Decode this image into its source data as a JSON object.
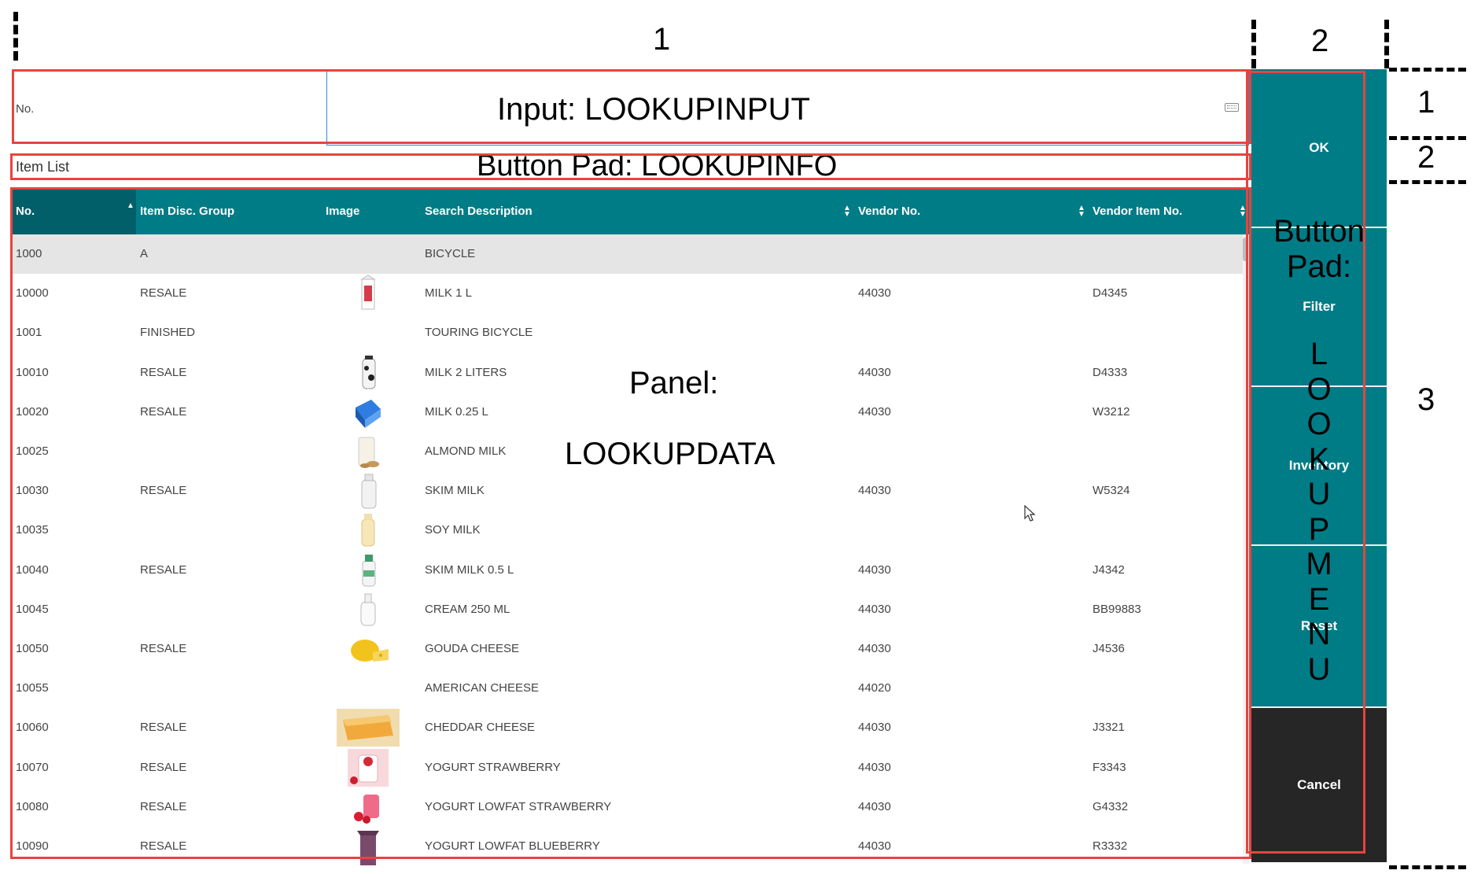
{
  "annotations": {
    "top_col1": "1",
    "top_col2": "2",
    "side_row1": "1",
    "side_row2": "2",
    "side_row3": "3",
    "input_label": "Input: LOOKUPINPUT",
    "info_label": "Button Pad: LOOKUPINFO",
    "panel_label_1": "Panel:",
    "panel_label_2": "LOOKUPDATA",
    "menu_label_1": "Button",
    "menu_label_2": "Pad:",
    "menu_label_letters": [
      "L",
      "O",
      "O",
      "K",
      "U",
      "P",
      "M",
      "E",
      "N",
      "U"
    ]
  },
  "input": {
    "label": "No.",
    "value": ""
  },
  "info": {
    "title": "Item List"
  },
  "table": {
    "columns": [
      "No.",
      "Item Disc. Group",
      "Image",
      "Search Description",
      "Vendor No.",
      "Vendor Item No."
    ],
    "rows": [
      {
        "no": "1000",
        "group": "A",
        "image": "",
        "desc": "BICYCLE",
        "vendor": "",
        "vendor_item": ""
      },
      {
        "no": "10000",
        "group": "RESALE",
        "image": "milk-carton",
        "desc": "MILK 1 L",
        "vendor": "44030",
        "vendor_item": "D4345"
      },
      {
        "no": "1001",
        "group": "FINISHED",
        "image": "",
        "desc": "TOURING BICYCLE",
        "vendor": "",
        "vendor_item": ""
      },
      {
        "no": "10010",
        "group": "RESALE",
        "image": "milk-cow-bottle",
        "desc": "MILK 2 LITERS",
        "vendor": "44030",
        "vendor_item": "D4333"
      },
      {
        "no": "10020",
        "group": "RESALE",
        "image": "milk-blue-box",
        "desc": "MILK 0.25 L",
        "vendor": "44030",
        "vendor_item": "W3212"
      },
      {
        "no": "10025",
        "group": "",
        "image": "almond-milk",
        "desc": "ALMOND MILK",
        "vendor": "",
        "vendor_item": ""
      },
      {
        "no": "10030",
        "group": "RESALE",
        "image": "skim-milk-bottle",
        "desc": "SKIM MILK",
        "vendor": "44030",
        "vendor_item": "W5324"
      },
      {
        "no": "10035",
        "group": "",
        "image": "soy-milk-bottle",
        "desc": "SOY MILK",
        "vendor": "",
        "vendor_item": ""
      },
      {
        "no": "10040",
        "group": "RESALE",
        "image": "small-milk-bottle",
        "desc": "SKIM MILK 0.5 L",
        "vendor": "44030",
        "vendor_item": "J4342"
      },
      {
        "no": "10045",
        "group": "",
        "image": "cream-bottle",
        "desc": "CREAM 250 ML",
        "vendor": "44030",
        "vendor_item": "BB99883"
      },
      {
        "no": "10050",
        "group": "RESALE",
        "image": "gouda-cheese",
        "desc": "GOUDA CHEESE",
        "vendor": "44030",
        "vendor_item": "J4536"
      },
      {
        "no": "10055",
        "group": "",
        "image": "",
        "desc": "AMERICAN CHEESE",
        "vendor": "44020",
        "vendor_item": ""
      },
      {
        "no": "10060",
        "group": "RESALE",
        "image": "cheddar-cheese",
        "desc": "CHEDDAR CHEESE",
        "vendor": "44030",
        "vendor_item": "J3321"
      },
      {
        "no": "10070",
        "group": "RESALE",
        "image": "yogurt-strawberry",
        "desc": "YOGURT STRAWBERRY",
        "vendor": "44030",
        "vendor_item": "F3343"
      },
      {
        "no": "10080",
        "group": "RESALE",
        "image": "yogurt-lowfat-strawberry",
        "desc": "YOGURT LOWFAT STRAWBERRY",
        "vendor": "44030",
        "vendor_item": "G4332"
      },
      {
        "no": "10090",
        "group": "RESALE",
        "image": "yogurt-blueberry",
        "desc": "YOGURT LOWFAT BLUEBERRY",
        "vendor": "44030",
        "vendor_item": "R3332"
      }
    ]
  },
  "menu": {
    "ok": "OK",
    "filter": "Filter",
    "inventory": "Inventory",
    "reset": "Reset",
    "cancel": "Cancel"
  },
  "colors": {
    "teal": "#007c87",
    "teal_dark": "#005f69",
    "annotation_red": "#e8433f",
    "cancel_bg": "#262626",
    "selected_row": "#e5e5e5"
  }
}
